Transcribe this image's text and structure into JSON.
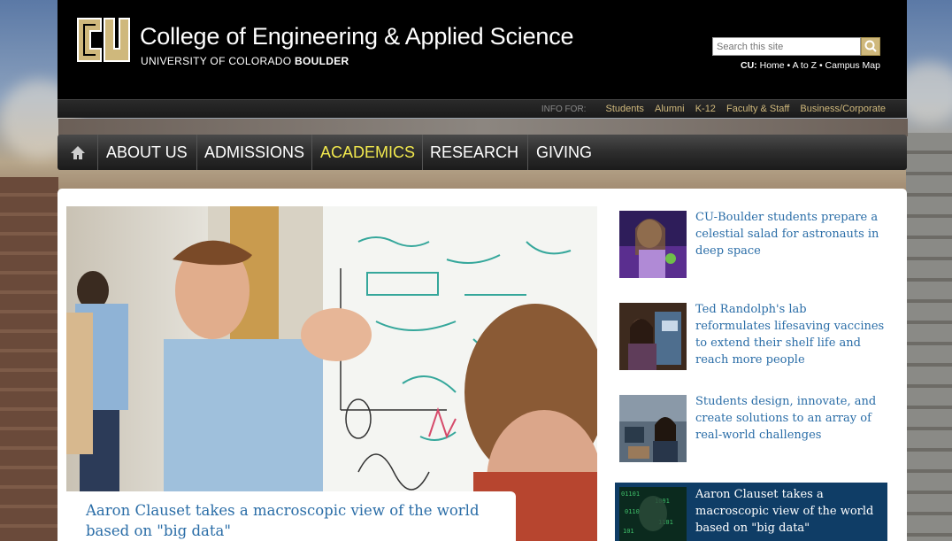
{
  "header": {
    "title": "College of Engineering & Applied Science",
    "subtitle_prefix": "UNIVERSITY OF COLORADO",
    "subtitle_bold": "BOULDER",
    "search_placeholder": "Search this site",
    "cu_label": "CU:",
    "cu_links": [
      "Home",
      "A to Z",
      "Campus Map"
    ],
    "separator": "•"
  },
  "infobar": {
    "label": "INFO FOR:",
    "links": [
      "Students",
      "Alumni",
      "K-12",
      "Faculty & Staff",
      "Business/Corporate"
    ]
  },
  "nav": {
    "items": [
      "ABOUT US",
      "ADMISSIONS",
      "ACADEMICS",
      "RESEARCH",
      "GIVING"
    ],
    "active": "ACADEMICS"
  },
  "hero": {
    "caption": "Aaron Clauset takes a macroscopic view of the world based on \"big data\""
  },
  "stories": [
    {
      "title": "CU-Boulder students prepare a celestial salad for astronauts in deep space"
    },
    {
      "title": "Ted Randolph's lab reformulates lifesaving vaccines to extend their shelf life and reach more people"
    },
    {
      "title": "Students design, innovate, and create solutions to an array of real-world challenges"
    },
    {
      "title": "Aaron Clauset takes a macroscopic view of the world based on \"big data\""
    }
  ],
  "colors": {
    "header_bg": "#000000",
    "cu_gold": "#cfb87c",
    "nav_active": "#f2e94e",
    "link_blue": "#2a6da7",
    "active_story_bg": "#0f3d66"
  },
  "icons": [
    "cu-logo-icon",
    "search-icon",
    "home-icon"
  ]
}
